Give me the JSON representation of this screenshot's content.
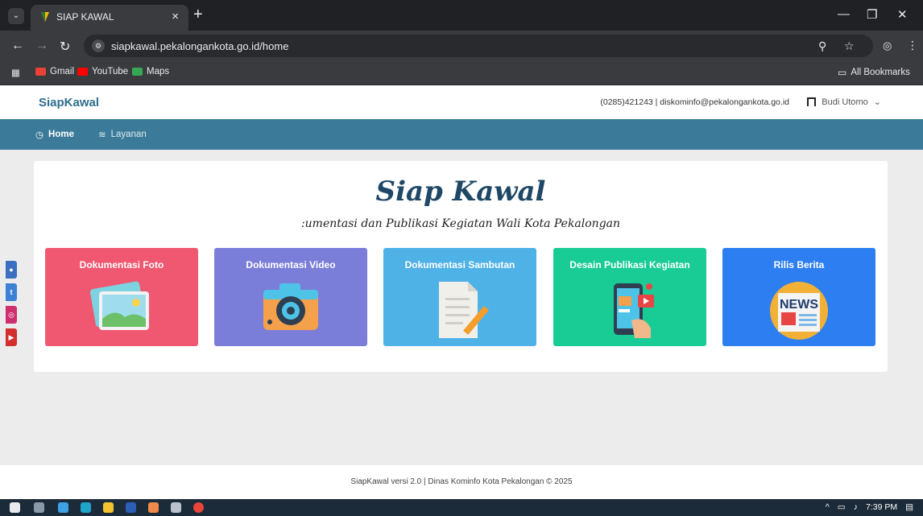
{
  "browser": {
    "tab_title": "SIAP KAWAL",
    "tab_close": "×",
    "new_tab": "+",
    "url": "siapkawal.pekalongankota.go.id/home",
    "bookmarks": [
      "Gmail",
      "YouTube",
      "Maps"
    ],
    "all_bookmarks": "All Bookmarks"
  },
  "header": {
    "brand": "SiapKawal",
    "contact": "(0285)421243 | diskominfo@pekalongankota.go.id",
    "user_name": "Budi Utomo",
    "user_caret": "⌄"
  },
  "nav": {
    "home": "Home",
    "layanan": "Layanan"
  },
  "hero": {
    "title": "Siap Kawal",
    "subtitle": ":umentasi dan Publikasi Kegiatan Wali Kota Pekalongan"
  },
  "tiles": [
    {
      "label": "Dokumentasi Foto",
      "color": "#ef5870",
      "icon": "photo-icon"
    },
    {
      "label": "Dokumentasi Video",
      "color": "#7b7ed8",
      "icon": "camera-icon"
    },
    {
      "label": "Dokumentasi Sambutan",
      "color": "#4fb2e6",
      "icon": "document-pencil-icon"
    },
    {
      "label": "Desain Publikasi Kegiatan",
      "color": "#19cc95",
      "icon": "phone-media-icon"
    },
    {
      "label": "Rilis Berita",
      "color": "#2d7ef0",
      "icon": "newspaper-icon"
    }
  ],
  "news_text": "NEWS",
  "footer": "SiapKawal versi 2.0 | Dinas Kominfo Kota Pekalongan © 2025",
  "taskbar": {
    "time": "7:39 PM"
  },
  "colors": {
    "brand": "#2e6e8e",
    "nav_bg": "#3b7a98"
  }
}
